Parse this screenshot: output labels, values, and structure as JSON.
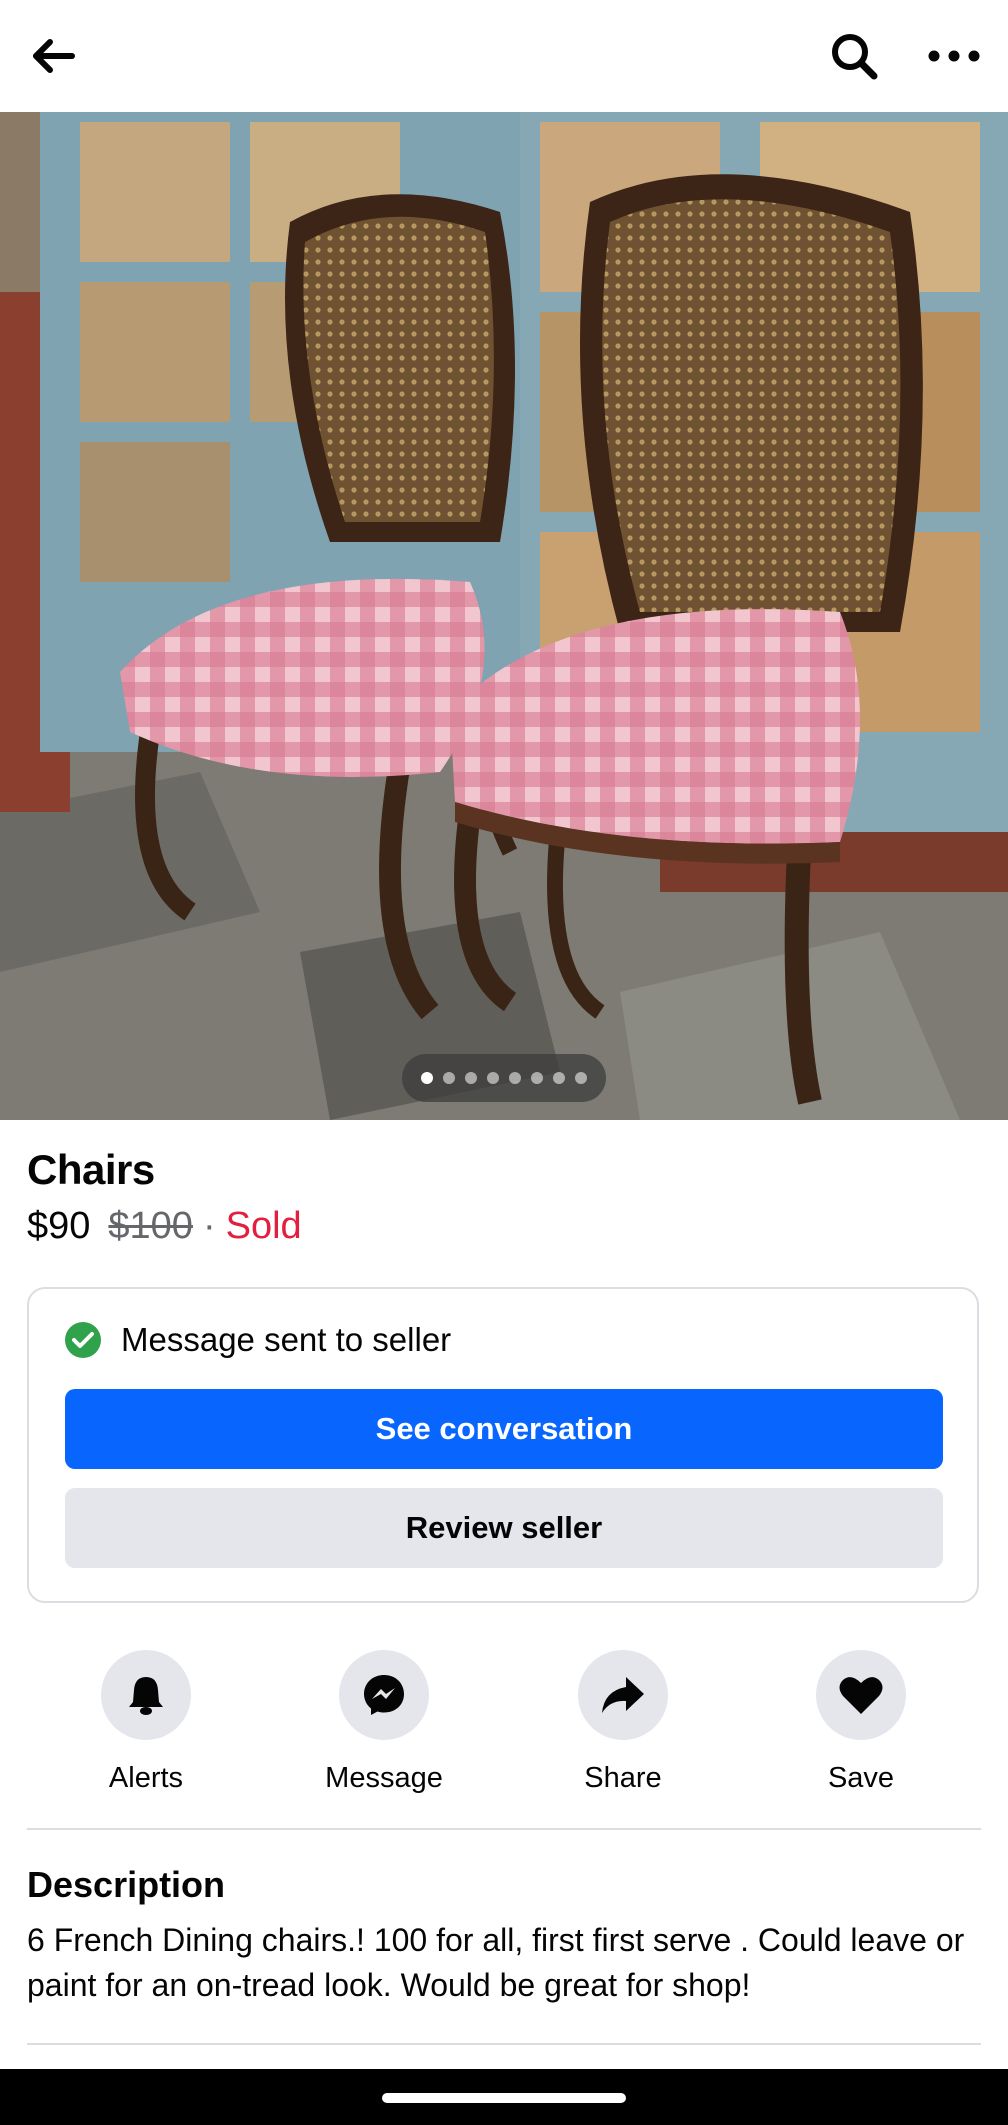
{
  "topbar": {
    "back_icon": "back-arrow-icon",
    "search_icon": "search-icon",
    "more_icon": "more-horizontal-icon"
  },
  "gallery": {
    "image_alt": "Two wooden cane-back dining chairs with pink gingham cushions",
    "photo_count": 8,
    "active_index": 0
  },
  "listing": {
    "title": "Chairs",
    "price": "$90",
    "original_price": "$100",
    "separator": "·",
    "status": "Sold",
    "status_color": "#e41e3f"
  },
  "message_card": {
    "status_text": "Message sent to seller",
    "primary_button": "See conversation",
    "secondary_button": "Review seller",
    "primary_color": "#0866ff",
    "check_color": "#31a24c"
  },
  "actions": [
    {
      "label": "Alerts",
      "icon": "bell-icon"
    },
    {
      "label": "Message",
      "icon": "messenger-icon"
    },
    {
      "label": "Share",
      "icon": "share-arrow-icon"
    },
    {
      "label": "Save",
      "icon": "heart-icon"
    }
  ],
  "description": {
    "heading": "Description",
    "text": "6 French Dining chairs.! 100 for all, first first serve . Could leave or paint for an on-tread look. Would be great for shop!"
  }
}
